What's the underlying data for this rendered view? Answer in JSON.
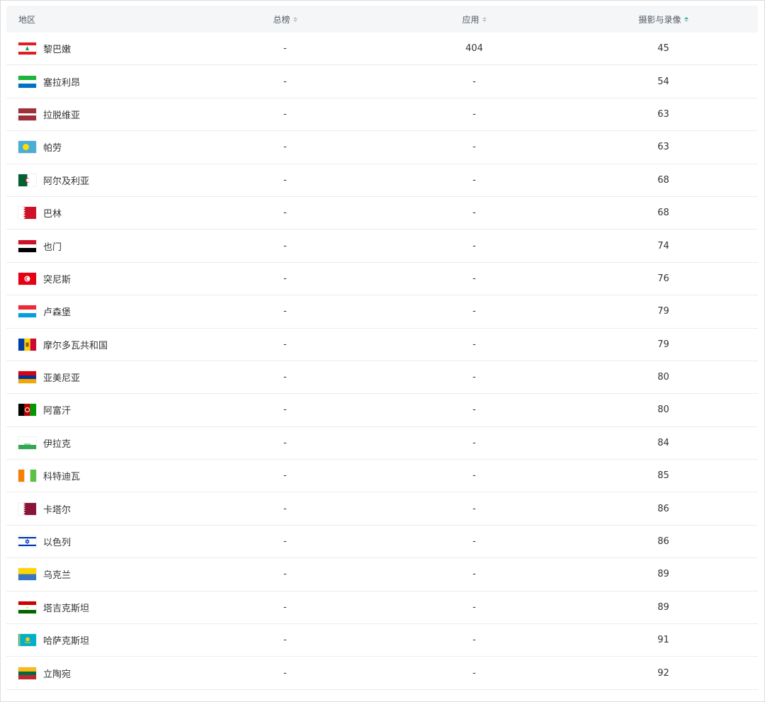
{
  "header": {
    "region": "地区",
    "total": "总榜",
    "apps": "应用",
    "photo_video": "摄影与录像"
  },
  "rows": [
    {
      "name": "黎巴嫩",
      "total": "-",
      "apps": "404",
      "photo": "45",
      "flag": "lebanon-flag-icon"
    },
    {
      "name": "塞拉利昂",
      "total": "-",
      "apps": "-",
      "photo": "54",
      "flag": "sierra-leone-flag-icon"
    },
    {
      "name": "拉脱维亚",
      "total": "-",
      "apps": "-",
      "photo": "63",
      "flag": "latvia-flag-icon"
    },
    {
      "name": "帕劳",
      "total": "-",
      "apps": "-",
      "photo": "63",
      "flag": "palau-flag-icon"
    },
    {
      "name": "阿尔及利亚",
      "total": "-",
      "apps": "-",
      "photo": "68",
      "flag": "algeria-flag-icon"
    },
    {
      "name": "巴林",
      "total": "-",
      "apps": "-",
      "photo": "68",
      "flag": "bahrain-flag-icon"
    },
    {
      "name": "也门",
      "total": "-",
      "apps": "-",
      "photo": "74",
      "flag": "yemen-flag-icon"
    },
    {
      "name": "突尼斯",
      "total": "-",
      "apps": "-",
      "photo": "76",
      "flag": "tunisia-flag-icon"
    },
    {
      "name": "卢森堡",
      "total": "-",
      "apps": "-",
      "photo": "79",
      "flag": "luxembourg-flag-icon"
    },
    {
      "name": "摩尔多瓦共和国",
      "total": "-",
      "apps": "-",
      "photo": "79",
      "flag": "moldova-flag-icon"
    },
    {
      "name": "亚美尼亚",
      "total": "-",
      "apps": "-",
      "photo": "80",
      "flag": "armenia-flag-icon"
    },
    {
      "name": "阿富汗",
      "total": "-",
      "apps": "-",
      "photo": "80",
      "flag": "afghanistan-flag-icon"
    },
    {
      "name": "伊拉克",
      "total": "-",
      "apps": "-",
      "photo": "84",
      "flag": "iraq-flag-icon"
    },
    {
      "name": "科特迪瓦",
      "total": "-",
      "apps": "-",
      "photo": "85",
      "flag": "ivory-coast-flag-icon"
    },
    {
      "name": "卡塔尔",
      "total": "-",
      "apps": "-",
      "photo": "86",
      "flag": "qatar-flag-icon"
    },
    {
      "name": "以色列",
      "total": "-",
      "apps": "-",
      "photo": "86",
      "flag": "israel-flag-icon"
    },
    {
      "name": "乌克兰",
      "total": "-",
      "apps": "-",
      "photo": "89",
      "flag": "ukraine-flag-icon"
    },
    {
      "name": "塔吉克斯坦",
      "total": "-",
      "apps": "-",
      "photo": "89",
      "flag": "tajikistan-flag-icon"
    },
    {
      "name": "哈萨克斯坦",
      "total": "-",
      "apps": "-",
      "photo": "91",
      "flag": "kazakhstan-flag-icon"
    },
    {
      "name": "立陶宛",
      "total": "-",
      "apps": "-",
      "photo": "92",
      "flag": "lithuania-flag-icon"
    }
  ],
  "colors": {
    "header_bg": "#f4f6f8",
    "active_sort": "#14b8a6",
    "inactive_sort": "#c0c4cc"
  }
}
